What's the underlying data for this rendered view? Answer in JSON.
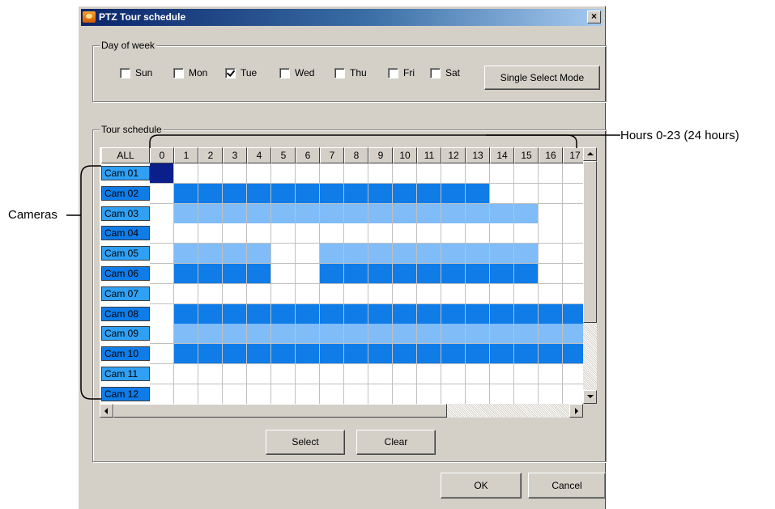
{
  "window": {
    "title": "PTZ Tour schedule",
    "close_label": "×"
  },
  "day_of_week": {
    "legend": "Day of week",
    "days": [
      {
        "label": "Sun",
        "checked": false
      },
      {
        "label": "Mon",
        "checked": false
      },
      {
        "label": "Tue",
        "checked": true
      },
      {
        "label": "Wed",
        "checked": false
      },
      {
        "label": "Thu",
        "checked": false
      },
      {
        "label": "Fri",
        "checked": false
      },
      {
        "label": "Sat",
        "checked": false
      }
    ],
    "mode_button": "Single Select Mode"
  },
  "tour_schedule": {
    "legend": "Tour schedule",
    "all_label": "ALL",
    "hours": [
      "0",
      "1",
      "2",
      "3",
      "4",
      "5",
      "6",
      "7",
      "8",
      "9",
      "10",
      "11",
      "12",
      "13",
      "14",
      "15",
      "16",
      "17"
    ],
    "cameras": [
      "Cam 01",
      "Cam 02",
      "Cam 03",
      "Cam 04",
      "Cam 05",
      "Cam 06",
      "Cam 07",
      "Cam 08",
      "Cam 09",
      "Cam 10",
      "Cam 11",
      "Cam 12"
    ],
    "rows": [
      {
        "pattern": "d-----------------"
      },
      {
        "pattern": "-bbbbbbbbbbbbb----"
      },
      {
        "pattern": "-lllllllllllllll--"
      },
      {
        "pattern": "------------------"
      },
      {
        "pattern": "-llll--lllllllll--"
      },
      {
        "pattern": "-bbbb--bbbbbbbbb--"
      },
      {
        "pattern": "------------------"
      },
      {
        "pattern": "-bbbbbbbbbbbbbbbbb"
      },
      {
        "pattern": "-lllllllllllllllll"
      },
      {
        "pattern": "-bbbbbbbbbbbbbbbbb"
      },
      {
        "pattern": "------------------"
      },
      {
        "pattern": "------------------"
      }
    ],
    "select_button": "Select",
    "clear_button": "Clear"
  },
  "footer": {
    "ok_button": "OK",
    "cancel_button": "Cancel"
  },
  "annotations": {
    "cameras": "Cameras",
    "hours": "Hours 0-23 (24 hours)"
  },
  "colors": {
    "dark": "#0a1f8a",
    "blue": "#0f7ce8",
    "light": "#7fbcf8",
    "white": "#ffffff"
  }
}
